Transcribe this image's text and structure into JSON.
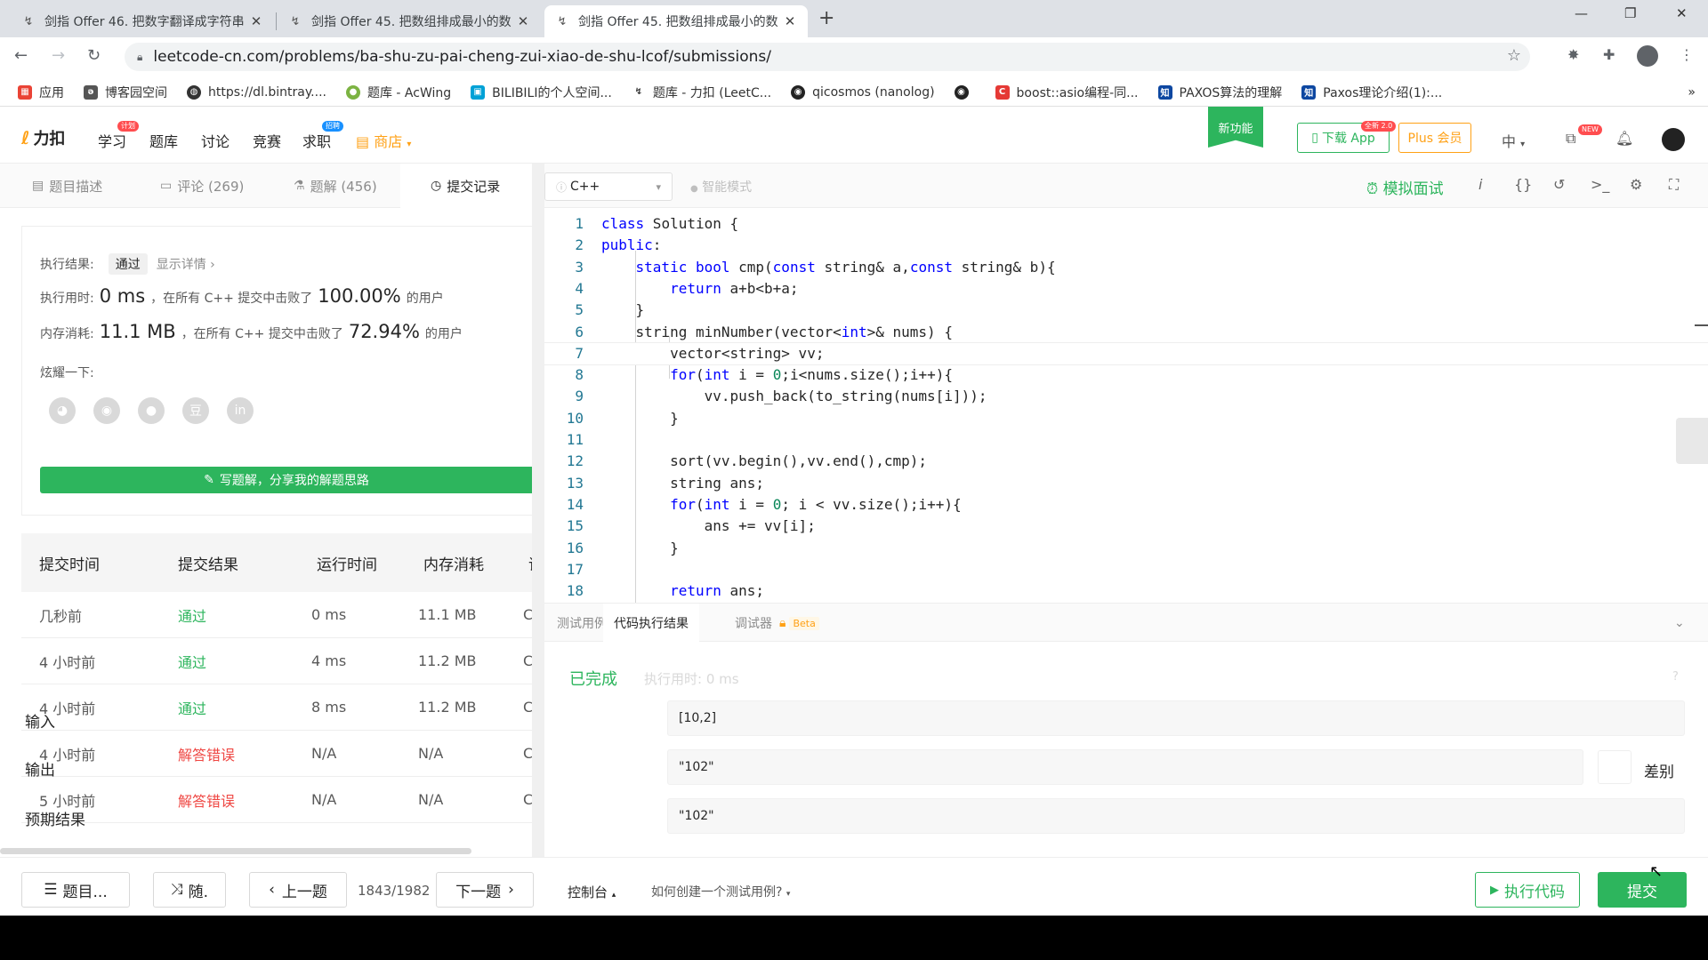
{
  "browser": {
    "tabs": [
      {
        "title": "剑指 Offer 46. 把数字翻译成字符串",
        "active": false
      },
      {
        "title": "剑指 Offer 45. 把数组排成最小的数",
        "active": false
      },
      {
        "title": "剑指 Offer 45. 把数组排成最小的数",
        "active": true
      }
    ],
    "url": "leetcode-cn.com/problems/ba-shu-zu-pai-cheng-zui-xiao-de-shu-lcof/submissions/",
    "bookmarks": [
      {
        "label": "应用",
        "color": "#ea4335"
      },
      {
        "label": "博客园空间",
        "color": "#555"
      },
      {
        "label": "https://dl.bintray....",
        "color": "#333"
      },
      {
        "label": "题库 - AcWing",
        "color": "#7cb342"
      },
      {
        "label": "BILIBILI的个人空间...",
        "color": "#00a1d6"
      },
      {
        "label": "题库 - 力扣 (LeetC...",
        "color": "#333"
      },
      {
        "label": "qicosmos (nanolog)",
        "color": "#222"
      },
      {
        "label": "",
        "color": "#222"
      },
      {
        "label": "boost::asio编程-同...",
        "color": "#e53935"
      },
      {
        "label": "PAXOS算法的理解",
        "color": "#0d47a1"
      },
      {
        "label": "Paxos理论介绍(1):...",
        "color": "#0d47a1"
      }
    ]
  },
  "nav": {
    "logo": "力扣",
    "items": [
      "学习",
      "题库",
      "讨论",
      "竞赛",
      "求职",
      "商店"
    ],
    "badge_learn": "计划",
    "badge_job": "招聘",
    "new_feature": "新功能",
    "download_app": "下载 App",
    "download_badge": "全新 2.0",
    "plus": "Plus 会员",
    "lang": "中",
    "new_badge": "NEW"
  },
  "left_tabs": [
    {
      "label": "题目描述",
      "icon": "description-icon"
    },
    {
      "label": "评论 (269)",
      "icon": "comment-icon"
    },
    {
      "label": "题解 (456)",
      "icon": "solution-icon"
    },
    {
      "label": "提交记录",
      "icon": "clock-icon"
    }
  ],
  "result": {
    "exec_label": "执行结果:",
    "status": "通过",
    "details": "显示详情 ›",
    "time_label": "执行用时:",
    "time_value": "0 ms",
    "time_mid": "，在所有 C++ 提交中击败了",
    "time_pct": "100.00%",
    "users": "的用户",
    "mem_label": "内存消耗:",
    "mem_value": "11.1 MB",
    "mem_mid": "，在所有 C++ 提交中击败了",
    "mem_pct": "72.94%",
    "share_label": "炫耀一下:",
    "share_icons": [
      "wechat-icon",
      "weibo-icon",
      "qq-icon",
      "douban-icon",
      "linkedin-icon"
    ],
    "write_solution": "写题解，分享我的解题思路"
  },
  "submissions": {
    "headers": [
      "提交时间",
      "提交结果",
      "运行时间",
      "内存消耗",
      "语"
    ],
    "rows": [
      {
        "time": "几秒前",
        "result": "通过",
        "ok": true,
        "runtime": "0 ms",
        "memory": "11.1 MB",
        "lang": "C"
      },
      {
        "time": "4 小时前",
        "result": "通过",
        "ok": true,
        "runtime": "4 ms",
        "memory": "11.2 MB",
        "lang": "C"
      },
      {
        "time": "4 小时前",
        "result": "通过",
        "ok": true,
        "runtime": "8 ms",
        "memory": "11.2 MB",
        "lang": "C"
      },
      {
        "time": "4 小时前",
        "result": "解答错误",
        "ok": false,
        "runtime": "N/A",
        "memory": "N/A",
        "lang": "C"
      },
      {
        "time": "5 小时前",
        "result": "解答错误",
        "ok": false,
        "runtime": "N/A",
        "memory": "N/A",
        "lang": "C"
      }
    ]
  },
  "editor": {
    "language": "C++",
    "smart_mode": "智能模式",
    "mock_interview": "模拟面试",
    "lines": [
      "class Solution {",
      "public:",
      "    static bool cmp(const string& a,const string& b){",
      "        return a+b<b+a;",
      "    }",
      "    string minNumber(vector<int>& nums) {",
      "        vector<string> vv;",
      "        for(int i = 0;i<nums.size();i++){",
      "            vv.push_back(to_string(nums[i]));",
      "        }",
      "",
      "        sort(vv.begin(),vv.end(),cmp);",
      "        string ans;",
      "        for(int i = 0; i < vv.size();i++){",
      "            ans += vv[i];",
      "        }",
      "",
      "        return ans;",
      "    }"
    ],
    "current_line": 7
  },
  "console": {
    "tabs": [
      "测试用例",
      "代码执行结果",
      "调试器"
    ],
    "beta": "Beta",
    "status": "已完成",
    "exec_time": "执行用时: 0 ms",
    "input_label": "输入",
    "input_value": "[10,2]",
    "output_label": "输出",
    "output_value": "\"102\"",
    "diff_label": "差别",
    "expected_label": "预期结果",
    "expected_value": "\"102\""
  },
  "bottom": {
    "problems": "题目...",
    "random": "随.",
    "prev": "上一题",
    "counter": "1843/1982",
    "next": "下一题",
    "console": "控制台",
    "howto": "如何创建一个测试用例?",
    "run": "执行代码",
    "submit": "提交"
  },
  "colors": {
    "accent": "#2db55d",
    "error": "#ef4743",
    "brand": "#ffa116"
  }
}
